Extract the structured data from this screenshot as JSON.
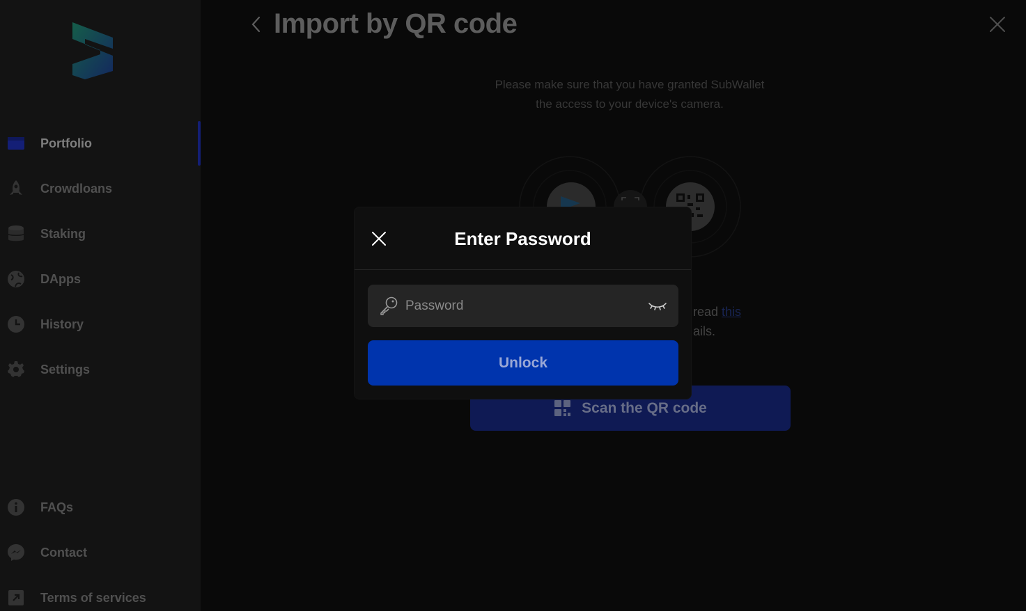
{
  "sidebar": {
    "items": [
      {
        "label": "Portfolio",
        "icon": "wallet-icon",
        "active": true
      },
      {
        "label": "Crowdloans",
        "icon": "rocket-icon"
      },
      {
        "label": "Staking",
        "icon": "database-icon"
      },
      {
        "label": "DApps",
        "icon": "globe-icon"
      },
      {
        "label": "History",
        "icon": "clock-icon"
      },
      {
        "label": "Settings",
        "icon": "gear-icon"
      }
    ],
    "bottom_items": [
      {
        "label": "FAQs",
        "icon": "info-icon"
      },
      {
        "label": "Contact",
        "icon": "messenger-icon"
      },
      {
        "label": "Terms of services",
        "icon": "external-link-icon"
      }
    ]
  },
  "header": {
    "title": "Import by QR code"
  },
  "main": {
    "instruction_line1": "Please make sure that you have granted SubWallet",
    "instruction_line2": "the access to your device's camera.",
    "read_more_prefix": "read ",
    "read_more_link": "this",
    "read_more_suffix": "ails.",
    "scan_label": "Scan the QR code"
  },
  "modal": {
    "title": "Enter Password",
    "password_placeholder": "Password",
    "password_value": "",
    "unlock_label": "Unlock"
  },
  "colors": {
    "accent": "#0034ad",
    "sidebar_bg": "#1a1a1a",
    "page_bg": "#0c0c0c",
    "logo_green": "#2fbf8f",
    "logo_blue": "#1b5fd6"
  }
}
